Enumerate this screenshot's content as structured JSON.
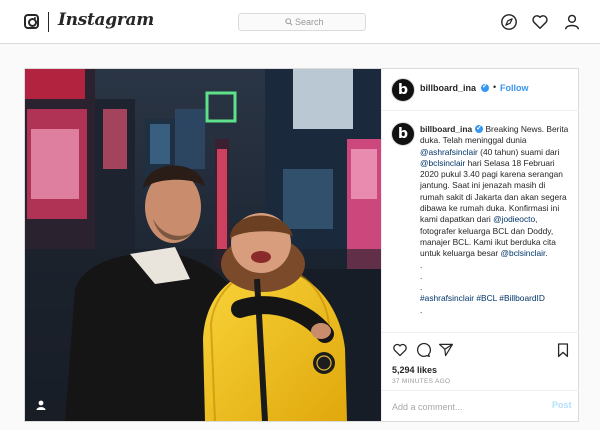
{
  "nav": {
    "brand": "Instagram",
    "search_placeholder": "Search",
    "icons": [
      "instagram-glyph-icon",
      "search-icon",
      "compass-icon",
      "heart-icon",
      "profile-icon"
    ]
  },
  "post": {
    "photo_alt": "Couple smiling in Times Square at night",
    "account": {
      "username": "billboard_ina",
      "avatar_letter": "b",
      "verified": true,
      "follow_label": "Follow",
      "separator": "•"
    },
    "caption": {
      "username": "billboard_ina",
      "t1": " Breaking News. Berita duka. Telah meninggal dunia ",
      "m1": "@ashrafsinclair",
      "t2": " (40 tahun) suami dari ",
      "m2": "@bclsinclair",
      "t3": " hari Selasa 18 Februari 2020 pukul 3.40 pagi karena serangan jantung. Saat ini jenazah masih di rumah sakit di Jakarta dan akan segera dibawa ke rumah duka. Konfirmasi ini kami dapatkan dari ",
      "m3": "@jodieocto",
      "t4": ", fotografer keluarga BCL dan Doddy, manajer BCL. Kami ikut berduka cita untuk keluarga besar ",
      "m4": "@bclsinclair",
      "t5": ".",
      "dots": [
        ".",
        ".",
        "."
      ],
      "h1": "#ashrafsinclair",
      "h2": "#BCL",
      "h3": "#BillboardID",
      "trailing": "."
    },
    "likes": "5,294 likes",
    "timestamp": "37 MINUTES AGO",
    "comment_placeholder": "Add a comment...",
    "post_label": "Post"
  },
  "colors": {
    "link_blue": "#3897f0",
    "border": "#dbdbdb",
    "jacket_yellow": "#f3c418"
  }
}
